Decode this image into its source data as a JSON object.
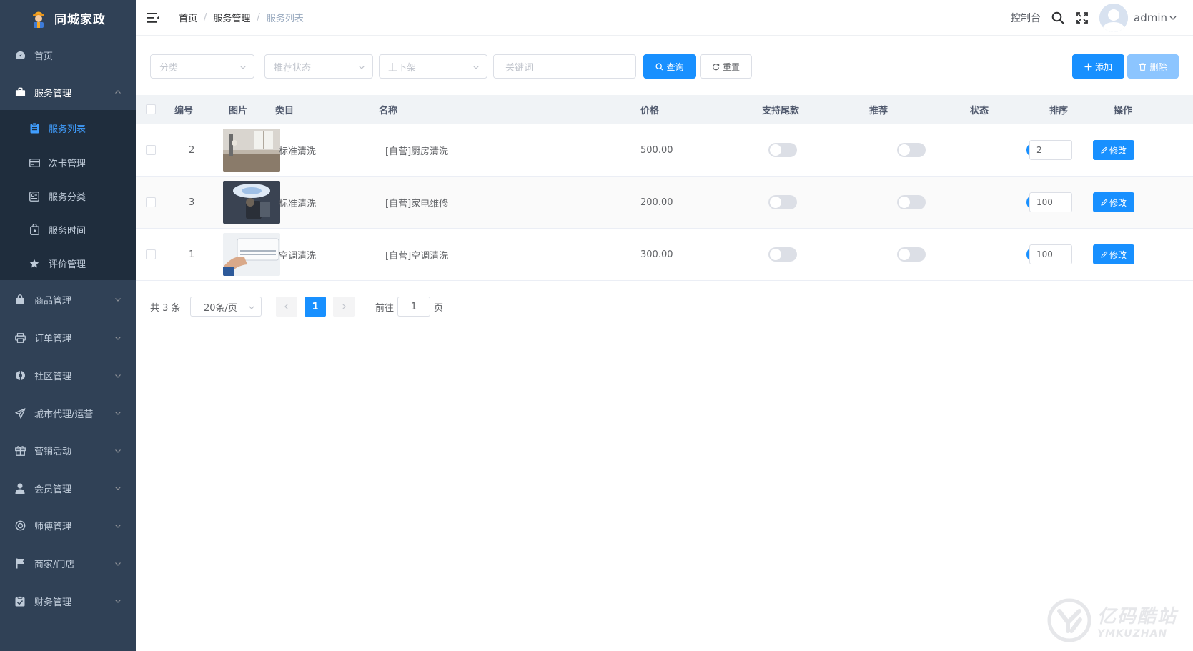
{
  "app": {
    "title": "同城家政"
  },
  "sidebar": {
    "items": [
      {
        "label": "首页",
        "icon": "dashboard-icon"
      },
      {
        "label": "服务管理",
        "icon": "briefcase-icon",
        "open": true,
        "children": [
          {
            "label": "服务列表",
            "icon": "clipboard-icon",
            "active": true
          },
          {
            "label": "次卡管理",
            "icon": "card-icon"
          },
          {
            "label": "服务分类",
            "icon": "category-icon"
          },
          {
            "label": "服务时间",
            "icon": "clock-bag-icon"
          },
          {
            "label": "评价管理",
            "icon": "star-icon"
          }
        ]
      },
      {
        "label": "商品管理",
        "icon": "shopping-bag-icon"
      },
      {
        "label": "订单管理",
        "icon": "printer-icon"
      },
      {
        "label": "社区管理",
        "icon": "community-icon"
      },
      {
        "label": "城市代理/运营",
        "icon": "send-icon"
      },
      {
        "label": "营销活动",
        "icon": "gift-icon"
      },
      {
        "label": "会员管理",
        "icon": "user-icon"
      },
      {
        "label": "师傅管理",
        "icon": "lifebuoy-icon"
      },
      {
        "label": "商家/门店",
        "icon": "flag-icon"
      },
      {
        "label": "财务管理",
        "icon": "finance-icon"
      }
    ]
  },
  "header": {
    "breadcrumb": [
      "首页",
      "服务管理",
      "服务列表"
    ],
    "console": "控制台",
    "username": "admin"
  },
  "filters": {
    "category_placeholder": "分类",
    "recommend_placeholder": "推荐状态",
    "shelf_placeholder": "上下架",
    "keyword_placeholder": "关键词",
    "search_label": "查询",
    "reset_label": "重置",
    "add_label": "添加",
    "delete_label": "删除"
  },
  "table": {
    "columns": [
      "编号",
      "图片",
      "类目",
      "名称",
      "价格",
      "支持尾款",
      "推荐",
      "状态",
      "排序",
      "操作"
    ],
    "rows": [
      {
        "id": "2",
        "category": "标准清洗",
        "name": "[自营]厨房清洗",
        "price": "500.00",
        "balance": false,
        "recommend": false,
        "status": true,
        "sort": "2",
        "action": "修改"
      },
      {
        "id": "3",
        "category": "标准清洗",
        "name": "[自营]家电维修",
        "price": "200.00",
        "balance": false,
        "recommend": false,
        "status": true,
        "sort": "100",
        "action": "修改"
      },
      {
        "id": "1",
        "category": "空调清洗",
        "name": "[自营]空调清洗",
        "price": "300.00",
        "balance": false,
        "recommend": false,
        "status": true,
        "sort": "100",
        "action": "修改"
      }
    ]
  },
  "pagination": {
    "total": "共 3 条",
    "page_size": "20条/页",
    "current_page": "1",
    "goto_label": "前往",
    "goto_value": "1",
    "page_suffix": "页"
  },
  "watermark": {
    "cn": "亿码酷站",
    "en": "YMKUZHAN"
  },
  "colors": {
    "sidebar_bg": "#304156",
    "submenu_bg": "#1f2d3d",
    "primary": "#1890ff",
    "active_text": "#409eff"
  }
}
